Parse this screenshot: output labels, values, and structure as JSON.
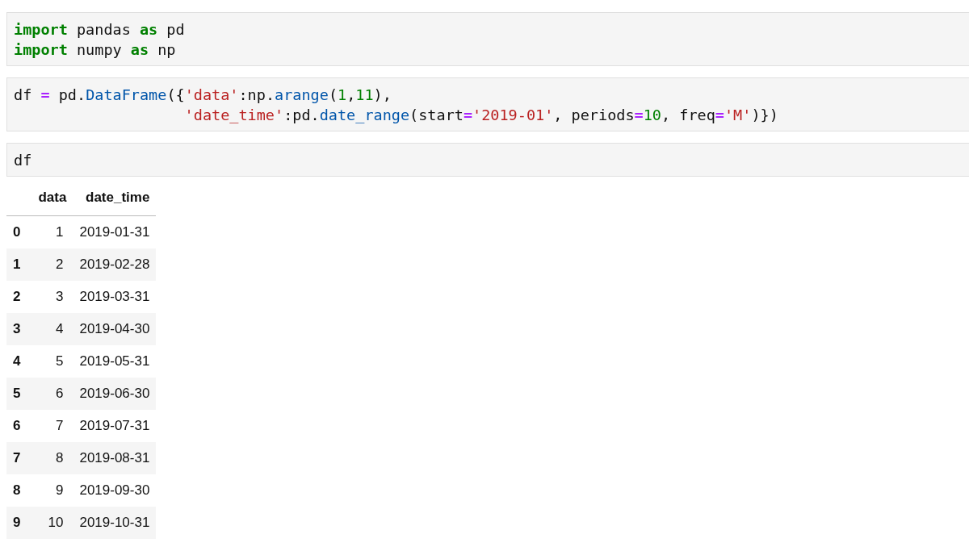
{
  "cells": [
    {
      "lines": [
        [
          {
            "text": "import",
            "kind": "keyword"
          },
          {
            "text": " pandas ",
            "kind": "plain"
          },
          {
            "text": "as",
            "kind": "keyword"
          },
          {
            "text": " pd",
            "kind": "plain"
          }
        ],
        [
          {
            "text": "import",
            "kind": "keyword"
          },
          {
            "text": " numpy ",
            "kind": "plain"
          },
          {
            "text": "as",
            "kind": "keyword"
          },
          {
            "text": " np",
            "kind": "plain"
          }
        ]
      ]
    },
    {
      "lines": [
        [
          {
            "text": "df ",
            "kind": "plain"
          },
          {
            "text": "=",
            "kind": "operator"
          },
          {
            "text": " pd.",
            "kind": "plain"
          },
          {
            "text": "DataFrame",
            "kind": "function"
          },
          {
            "text": "({",
            "kind": "plain"
          },
          {
            "text": "'data'",
            "kind": "string"
          },
          {
            "text": ":np.",
            "kind": "plain"
          },
          {
            "text": "arange",
            "kind": "function"
          },
          {
            "text": "(",
            "kind": "plain"
          },
          {
            "text": "1",
            "kind": "number"
          },
          {
            "text": ",",
            "kind": "plain"
          },
          {
            "text": "11",
            "kind": "number"
          },
          {
            "text": "),",
            "kind": "plain"
          }
        ],
        [
          {
            "text": "                   'date_time'",
            "kind": "string"
          },
          {
            "text": ":pd.",
            "kind": "plain"
          },
          {
            "text": "date_range",
            "kind": "function"
          },
          {
            "text": "(start",
            "kind": "plain"
          },
          {
            "text": "=",
            "kind": "operator"
          },
          {
            "text": "'2019-01'",
            "kind": "string"
          },
          {
            "text": ", periods",
            "kind": "plain"
          },
          {
            "text": "=",
            "kind": "operator"
          },
          {
            "text": "10",
            "kind": "number"
          },
          {
            "text": ", freq",
            "kind": "plain"
          },
          {
            "text": "=",
            "kind": "operator"
          },
          {
            "text": "'M'",
            "kind": "string"
          },
          {
            "text": ")})",
            "kind": "plain"
          }
        ]
      ]
    },
    {
      "lines": [
        [
          {
            "text": "df",
            "kind": "plain"
          }
        ]
      ]
    }
  ],
  "table": {
    "columns": [
      "data",
      "date_time"
    ],
    "rows": [
      {
        "index": "0",
        "cells": [
          "1",
          "2019-01-31"
        ]
      },
      {
        "index": "1",
        "cells": [
          "2",
          "2019-02-28"
        ]
      },
      {
        "index": "2",
        "cells": [
          "3",
          "2019-03-31"
        ]
      },
      {
        "index": "3",
        "cells": [
          "4",
          "2019-04-30"
        ]
      },
      {
        "index": "4",
        "cells": [
          "5",
          "2019-05-31"
        ]
      },
      {
        "index": "5",
        "cells": [
          "6",
          "2019-06-30"
        ]
      },
      {
        "index": "6",
        "cells": [
          "7",
          "2019-07-31"
        ]
      },
      {
        "index": "7",
        "cells": [
          "8",
          "2019-08-31"
        ]
      },
      {
        "index": "8",
        "cells": [
          "9",
          "2019-09-30"
        ]
      },
      {
        "index": "9",
        "cells": [
          "10",
          "2019-10-31"
        ]
      }
    ]
  }
}
